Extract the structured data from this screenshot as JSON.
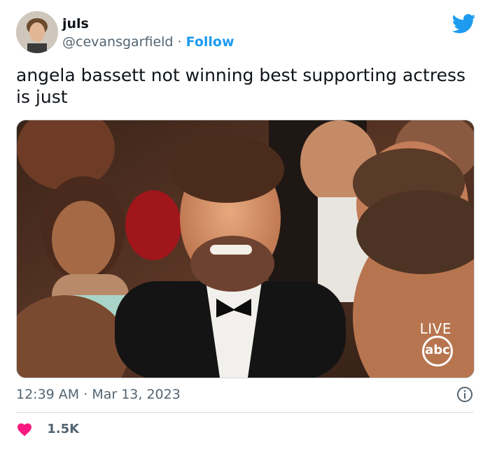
{
  "user": {
    "display_name": "juls",
    "handle": "@cevansgarfield",
    "separator": "·",
    "follow_label": "Follow"
  },
  "tweet": {
    "text": "angela bassett not winning best supporting actress is just"
  },
  "media": {
    "live_label": "LIVE",
    "network_logo": "abc"
  },
  "meta": {
    "time": "12:39 AM",
    "separator": "·",
    "date": "Mar 13, 2023"
  },
  "engagement": {
    "likes": "1.5K"
  },
  "icons": {
    "brand": "twitter-bird-icon",
    "info": "info-icon",
    "like": "heart-icon"
  },
  "colors": {
    "accent": "#1d9bf0",
    "heart": "#f91880",
    "muted_text": "#536471",
    "text": "#0f1419"
  }
}
